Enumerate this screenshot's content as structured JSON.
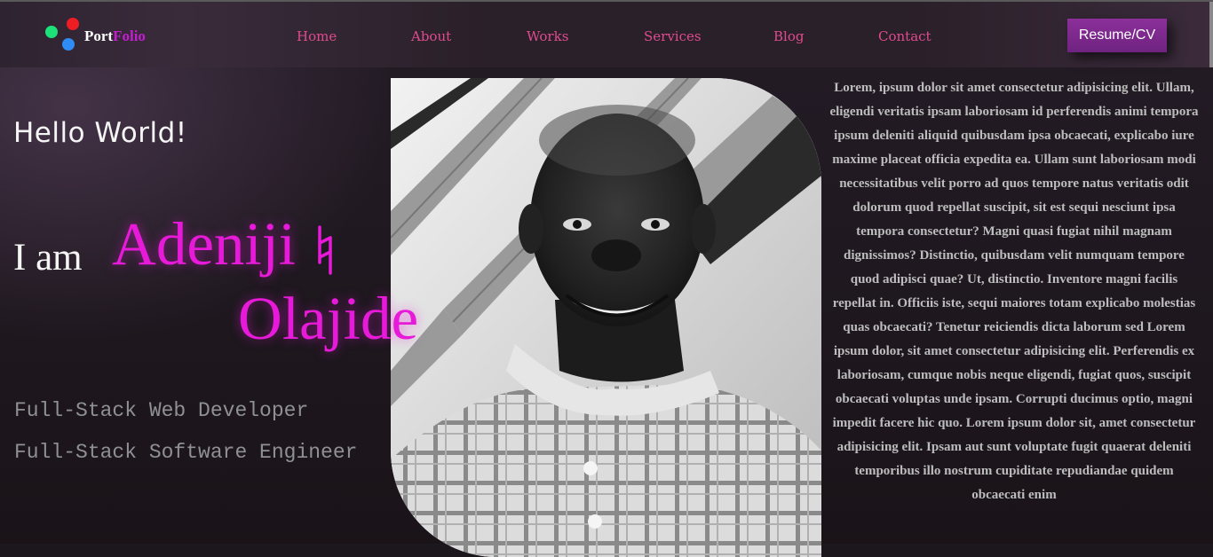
{
  "nav": {
    "logo": {
      "part1": "Port",
      "part2": "Folio"
    },
    "links": [
      "Home",
      "About",
      "Works",
      "Services",
      "Blog",
      "Contact"
    ],
    "resume_label": "Resume/CV"
  },
  "hero": {
    "greeting": "Hello World!",
    "intro": "I am",
    "name_first": "Adeniji",
    "name_last": "Olajide",
    "roles": [
      "Full-Stack Web Developer",
      "Full-Stack Software Engineer"
    ]
  },
  "about": {
    "text": "Lorem, ipsum dolor sit amet consectetur adipisicing elit. Ullam, eligendi veritatis ipsam laboriosam id perferendis animi tempora ipsum deleniti aliquid quibusdam ipsa obcaecati, explicabo iure maxime placeat officia expedita ea. Ullam sunt laboriosam modi necessitatibus velit porro ad quos tempore natus veritatis odit dolorum quod repellat suscipit, sit est sequi nesciunt ipsa tempora consectetur? Magni quasi fugiat nihil magnam dignissimos? Distinctio, quibusdam velit numquam tempore quod adipisci quae? Ut, distinctio. Inventore magni facilis repellat in. Officiis iste, sequi maiores totam explicabo molestias quas obcaecati? Tenetur reiciendis dicta laborum sed Lorem ipsum dolor, sit amet consectetur adipisicing elit. Perferendis ex laboriosam, cumque nobis neque eligendi, fugiat quos, suscipit obcaecati voluptas unde ipsam. Corrupti ducimus optio, magni impedit facere hic quo. Lorem ipsum dolor sit, amet consectetur adipisicing elit. Ipsam aut sunt voluptate fugit quaerat deleniti temporibus illo nostrum cupiditate repudiandae quidem obcaecati enim"
  },
  "colors": {
    "accent": "#e61ad8",
    "nav_link": "#e04b8f",
    "button": "#8c2f9a"
  }
}
